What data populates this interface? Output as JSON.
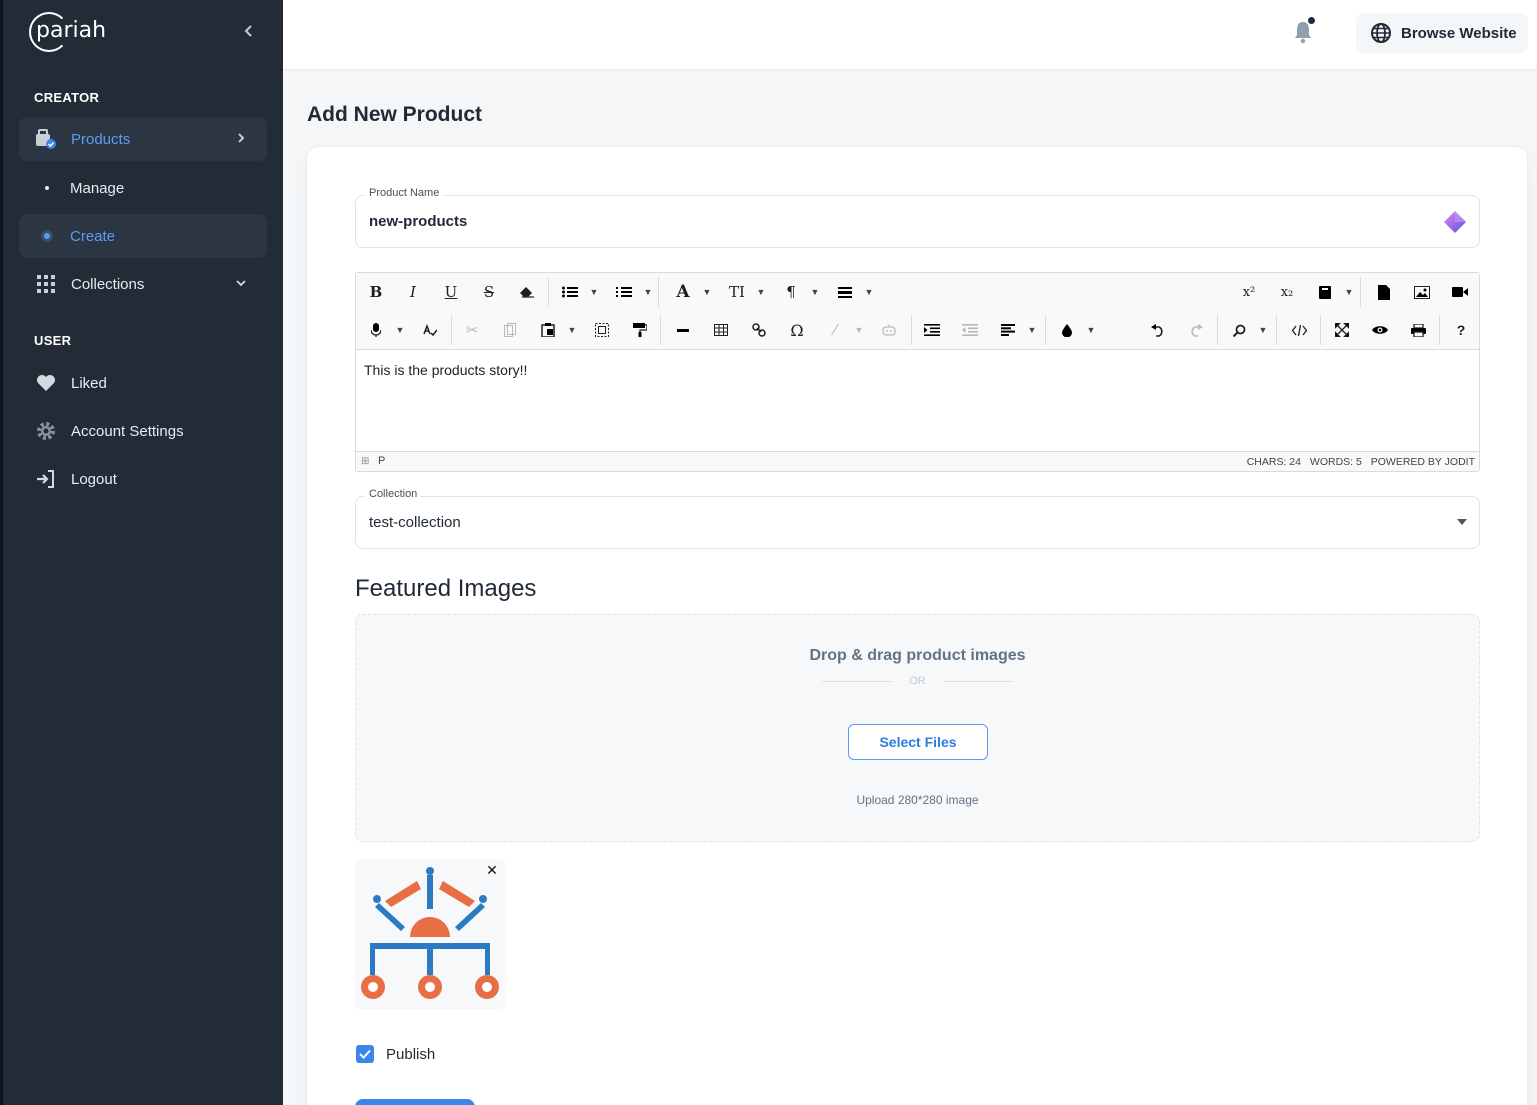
{
  "app": {
    "logo_text": "pariah"
  },
  "sidebar": {
    "section_creator": "CREATOR",
    "section_user": "USER",
    "products_label": "Products",
    "manage_label": "Manage",
    "create_label": "Create",
    "collections_label": "Collections",
    "liked_label": "Liked",
    "account_settings_label": "Account Settings",
    "logout_label": "Logout"
  },
  "topbar": {
    "browse_label": "Browse Website"
  },
  "page": {
    "title": "Add New Product"
  },
  "form": {
    "product_name_label": "Product Name",
    "product_name_value": "new-products",
    "editor_content": "This is the products story!!",
    "editor_path": "P",
    "editor_chars": "CHARS: 24",
    "editor_words": "WORDS: 5",
    "editor_powered": "POWERED BY JODIT",
    "collection_label": "Collection",
    "collection_value": "test-collection",
    "featured_title": "Featured Images",
    "dropzone_title": "Drop & drag product images",
    "dropzone_or": "OR",
    "select_files_label": "Select Files",
    "upload_hint": "Upload 280*280 image",
    "publish_label": "Publish",
    "publish_checked": true
  },
  "colors": {
    "sidebar_bg": "#222b36",
    "accent": "#3b86e8",
    "active_text": "#5b9cf2"
  }
}
